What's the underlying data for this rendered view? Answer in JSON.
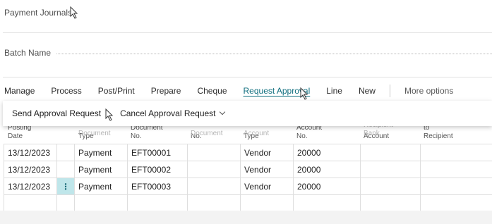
{
  "header": {
    "title": "Payment Journals"
  },
  "batch": {
    "label": "Batch Name"
  },
  "actions": [
    {
      "label": "Manage"
    },
    {
      "label": "Process"
    },
    {
      "label": "Post/Print"
    },
    {
      "label": "Prepare"
    },
    {
      "label": "Cheque"
    },
    {
      "label": "Request Approval",
      "active": true
    },
    {
      "label": "Line"
    },
    {
      "label": "New"
    }
  ],
  "more_options": "More options",
  "popup": {
    "send": "Send Approval Request",
    "cancel": "Cancel Approval Request"
  },
  "columns": {
    "posting_date": "Posting Date",
    "doc_type_top": "Document",
    "doc_type": "Type",
    "doc_no": "Document No.",
    "ext_doc_top": "Document",
    "ext_doc": "No.",
    "acc_type_top": "Account",
    "acc_type": "Type",
    "acc_no": "Account No.",
    "recipient_top": "Recipient Bank",
    "recipient": "Account",
    "message": "Message to Recipient"
  },
  "rows": [
    {
      "posting_date": "13/12/2023",
      "doc_type": "Payment",
      "doc_no": "EFT00001",
      "ext_doc": "",
      "acc_type": "Vendor",
      "acc_no": "20000",
      "recipient": "",
      "message": ""
    },
    {
      "posting_date": "13/12/2023",
      "doc_type": "Payment",
      "doc_no": "EFT00002",
      "ext_doc": "",
      "acc_type": "Vendor",
      "acc_no": "20000",
      "recipient": "",
      "message": ""
    },
    {
      "posting_date": "13/12/2023",
      "doc_type": "Payment",
      "doc_no": "EFT00003",
      "ext_doc": "",
      "acc_type": "Vendor",
      "acc_no": "20000",
      "recipient": "",
      "message": "",
      "selected": true
    }
  ],
  "row_menu_glyph": "⋮",
  "colors": {
    "accent": "#0f6e7e",
    "selected_cell": "#bfe6ea"
  }
}
